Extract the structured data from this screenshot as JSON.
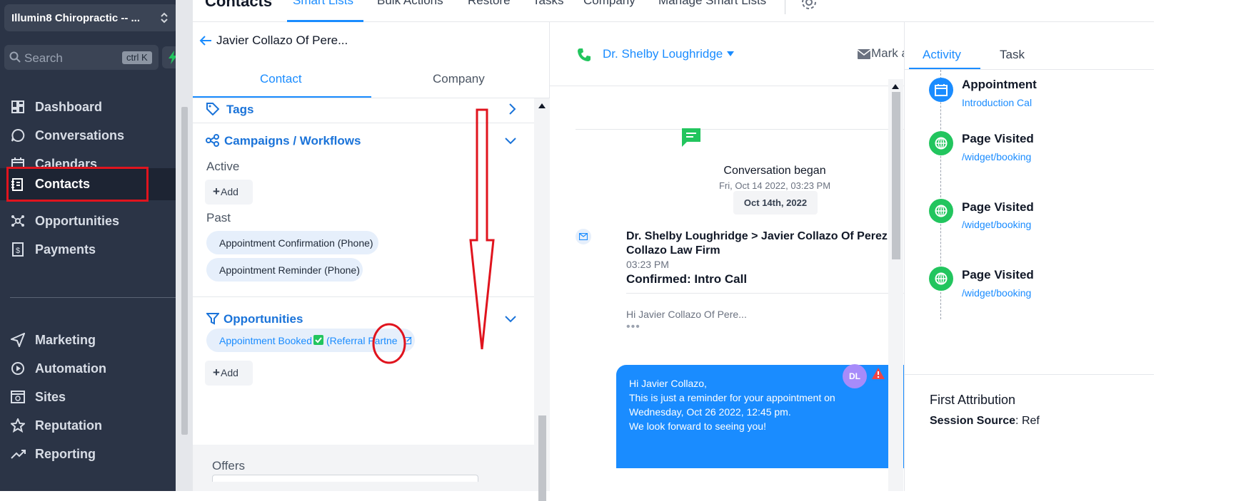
{
  "sidebar": {
    "location_name": "Illumin8 Chiropractic -- ...",
    "search_placeholder": "Search",
    "search_shortcut": "ctrl K",
    "items": [
      {
        "label": "Dashboard",
        "icon": "dashboard-icon"
      },
      {
        "label": "Conversations",
        "icon": "chat-icon"
      },
      {
        "label": "Calendars",
        "icon": "calendar-icon"
      },
      {
        "label": "Contacts",
        "icon": "contacts-icon",
        "active": true
      },
      {
        "label": "Opportunities",
        "icon": "opportunities-icon"
      },
      {
        "label": "Payments",
        "icon": "payments-icon"
      },
      {
        "label": "Marketing",
        "icon": "send-icon"
      },
      {
        "label": "Automation",
        "icon": "automation-icon"
      },
      {
        "label": "Sites",
        "icon": "sites-icon"
      },
      {
        "label": "Reputation",
        "icon": "star-icon"
      },
      {
        "label": "Reporting",
        "icon": "trend-icon"
      }
    ]
  },
  "header": {
    "title": "Contacts",
    "tabs": [
      "Smart Lists",
      "Bulk Actions",
      "Restore",
      "Tasks",
      "Company",
      "Manage Smart Lists"
    ]
  },
  "contact_panel": {
    "name": "Javier Collazo Of Pere...",
    "tabs": [
      "Contact",
      "Company"
    ],
    "tags_label": "Tags",
    "campaigns_label": "Campaigns / Workflows",
    "active_label": "Active",
    "past_label": "Past",
    "add_label": "Add",
    "past_items": [
      "Appointment Confirmation (Phone)",
      "Appointment Reminder (Phone)"
    ],
    "opportunities_label": "Opportunities",
    "opportunity": {
      "name": "Appointment Booked",
      "pipeline": "(Referral Partne"
    },
    "offers_label": "Offers"
  },
  "conversation": {
    "from": "Dr. Shelby Loughridge",
    "mark_unread": "Mark as Unread",
    "began_title": "Conversation began",
    "began_date": "Fri, Oct 14 2022, 03:23 PM",
    "date_chip": "Oct 14th, 2022",
    "email_subject_1": "Dr. Shelby Loughridge > Javier Collazo Of Perez",
    "email_subject_2": "Collazo Law Firm",
    "email_time": "03:23 PM",
    "email_title": "Confirmed: Intro Call",
    "email_preview": "Hi Javier Collazo Of Pere...",
    "email_dots": "•••",
    "sms_lines": [
      "Hi Javier Collazo,",
      "This is just a reminder for your appointment on",
      "Wednesday, Oct 26 2022, 12:45 pm.",
      "We look forward to seeing you!"
    ],
    "avatar_initials": "DL"
  },
  "activity": {
    "tabs": [
      "Activity",
      "Task"
    ],
    "events": [
      {
        "title": "Appointment",
        "link": "Introduction Cal",
        "color": "#1a8cff",
        "icon": "calendar-icon"
      },
      {
        "title": "Page Visited",
        "link": "/widget/booking",
        "color": "#22c55e",
        "icon": "globe-icon"
      },
      {
        "title": "Page Visited",
        "link": "/widget/booking",
        "color": "#22c55e",
        "icon": "globe-icon"
      },
      {
        "title": "Page Visited",
        "link": "/widget/booking",
        "color": "#22c55e",
        "icon": "globe-icon"
      }
    ],
    "attribution_title": "First Attribution",
    "session_source_label": "Session Source",
    "session_source_value": ": Ref"
  },
  "colors": {
    "sidebar_bg": "#2b3446",
    "accent": "#1a8cff",
    "annotation_red": "#e0141e",
    "success_green": "#22c55e"
  }
}
